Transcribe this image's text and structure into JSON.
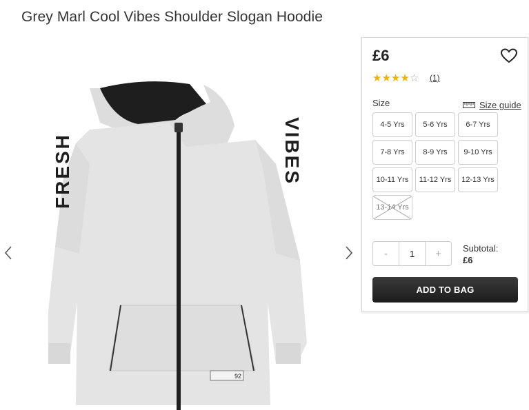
{
  "product": {
    "title": "Grey Marl Cool Vibes Shoulder Slogan Hoodie",
    "price": "£6",
    "rating": {
      "stars": 4,
      "max": 5,
      "count_label": "(1)"
    },
    "image_text": {
      "left_sleeve": "FRESH",
      "right_sleeve": "VIBES",
      "badge": "92"
    }
  },
  "icons": {
    "wishlist": "heart-icon",
    "size_guide": "ruler-icon",
    "prev": "chevron-left-icon",
    "next": "chevron-right-icon"
  },
  "size": {
    "label": "Size",
    "guide_label": "Size guide",
    "options": [
      {
        "label": "4-5 Yrs",
        "available": true
      },
      {
        "label": "5-6 Yrs",
        "available": true
      },
      {
        "label": "6-7 Yrs",
        "available": true
      },
      {
        "label": "7-8 Yrs",
        "available": true
      },
      {
        "label": "8-9 Yrs",
        "available": true
      },
      {
        "label": "9-10 Yrs",
        "available": true
      },
      {
        "label": "10-11 Yrs",
        "available": true
      },
      {
        "label": "11-12 Yrs",
        "available": true
      },
      {
        "label": "12-13 Yrs",
        "available": true
      },
      {
        "label": "13-14 Yrs",
        "available": false
      }
    ]
  },
  "quantity": {
    "minus": "-",
    "value": "1",
    "plus": "+"
  },
  "subtotal": {
    "label": "Subtotal:",
    "value": "£6"
  },
  "cta": {
    "add_to_bag": "ADD TO BAG"
  },
  "colors": {
    "star": "#f2b200",
    "button": "#222222",
    "hoodie": "#e3e3e3",
    "hood_lining": "#1e1e1e"
  }
}
